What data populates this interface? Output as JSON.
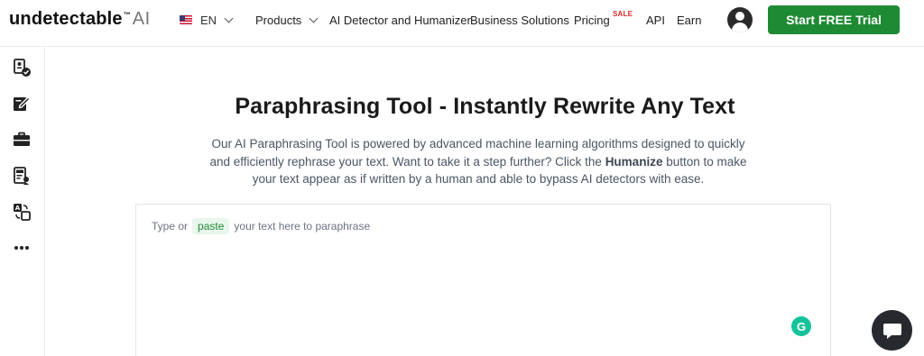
{
  "header": {
    "logo": {
      "word": "undetectable",
      "tm": "™",
      "ai": "AI"
    },
    "language": "EN",
    "nav": {
      "products": "Products",
      "ai_detector": "AI Detector and Humanizer",
      "business": "Business Solutions",
      "pricing": "Pricing",
      "sale_badge": "SALE",
      "api": "API",
      "earn": "Earn"
    },
    "cta_label": "Start FREE Trial"
  },
  "sidebar": {
    "items": [
      {
        "icon": "ai-detector-icon"
      },
      {
        "icon": "pen-edit-icon"
      },
      {
        "icon": "briefcase-icon"
      },
      {
        "icon": "seo-document-icon"
      },
      {
        "icon": "translate-icon"
      },
      {
        "icon": "more-dots-icon"
      }
    ]
  },
  "main": {
    "title": "Paraphrasing Tool - Instantly Rewrite Any Text",
    "description_part1": "Our AI Paraphrasing Tool is powered by advanced machine learning algorithms designed to quickly and efficiently rephrase your text. Want to take it a step further? Click the ",
    "description_bold": "Humanize",
    "description_part2": " button to make your text appear as if written by a human and able to bypass AI detectors with ease.",
    "editor": {
      "placeholder_before": "Type or",
      "paste_label": "paste",
      "placeholder_after": "your text here to paraphrase"
    }
  },
  "widgets": {
    "grammarly_letter": "G",
    "chat_icon": "chat-bubble-icon"
  },
  "colors": {
    "accent_green": "#1f8a34",
    "sale_red": "#e02424",
    "grammarly_green": "#15c39a",
    "chat_dark": "#262a2e"
  }
}
